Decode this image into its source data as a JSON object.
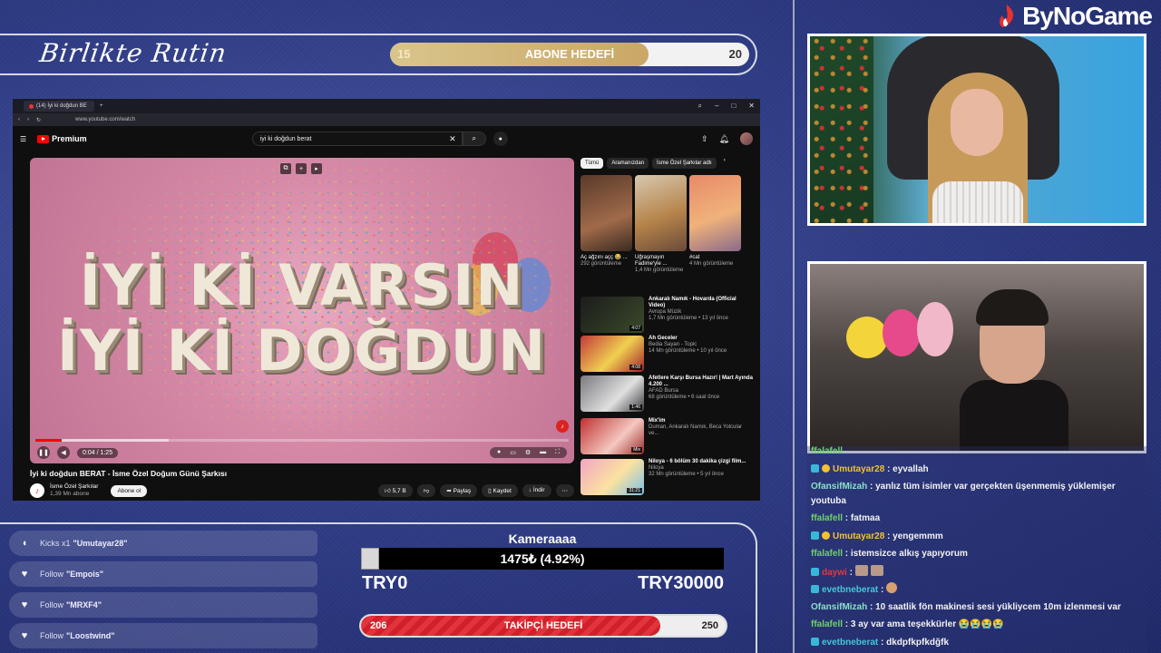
{
  "brand": {
    "name": "ByNoGame"
  },
  "banner": {
    "script_title": "Birlikte Rutin",
    "goal": {
      "label": "ABONE HEDEFİ",
      "current": "15",
      "target": "20",
      "progress": 0.72
    }
  },
  "browser": {
    "tab_title": "(14) İyi ki doğdun BE",
    "url": "www.youtube.com/watch",
    "youtube": {
      "logo": "Premium",
      "search_query": "iyi ki doğdun berat",
      "video": {
        "overlay_line1": "İYİ Kİ VARSIN",
        "overlay_line2": "İYİ Kİ DOĞDUN",
        "time": "0:04 / 1:25",
        "progress": 0.05,
        "buffered": 0.25,
        "title": "İyi ki doğdun BERAT - İsme Özel Doğum Günü Şarkısı",
        "channel": "İsme Özel Şarkılar",
        "subscribers": "1,39 Mn abone",
        "subscribe_label": "Abone ol",
        "likes": "5,7 B",
        "share_label": "Paylaş",
        "save_label": "Kaydet",
        "download_label": "İndir"
      },
      "chips": [
        "Tümü",
        "Aramanızdan",
        "İsme Özel Şarkılar adlı"
      ],
      "shorts": [
        {
          "title": "Aç ağzını açç 😂 ...",
          "views": "292 görüntüleme"
        },
        {
          "title": "Uğraşmayın Fadime'yle ...",
          "views": "1,4 Mn görüntüleme"
        },
        {
          "title": "#cat",
          "views": "4 Mn görüntüleme"
        }
      ],
      "recommendations": [
        {
          "title": "Ankaralı Namık - Hovarda (Official Video)",
          "channel": "Avrupa Müzik",
          "meta": "1,7 Mn görüntüleme • 13 yıl önce",
          "duration": "4:07"
        },
        {
          "title": "Ah Geceler",
          "channel": "Bedia Sayan - Topic",
          "meta": "14 Mn görüntüleme • 10 yıl önce",
          "duration": "4:08"
        },
        {
          "title": "Afetlere Karşı Bursa Hazır! | Mart Ayında 4.200 ...",
          "channel": "AFAD Bursa",
          "meta": "68 görüntüleme • 6 saat önce",
          "duration": "1:46"
        },
        {
          "title": "Mix'im",
          "channel": "Duman, Ankaralı Namık, Beca Yolcular ve...",
          "meta": "",
          "duration": "Mix"
        },
        {
          "title": "Niloya - 6 bölüm 30 dakika çizgi film...",
          "channel": "Niloya",
          "meta": "32 Mn görüntüleme • 5 yıl önce",
          "duration": "31:21"
        }
      ]
    }
  },
  "events": [
    {
      "type": "Kicks x1",
      "user": "\"Umutayar28\""
    },
    {
      "type": "Follow",
      "user": "\"Empois\""
    },
    {
      "type": "Follow",
      "user": "\"MRXF4\""
    },
    {
      "type": "Follow",
      "user": "\"Loostwind\""
    }
  ],
  "camera_goal": {
    "title": "Kameraaaa",
    "amount": "1475₺ (4.92%)",
    "progress": 0.0492,
    "min": "TRY0",
    "max": "TRY30000"
  },
  "follower_goal": {
    "label": "TAKİPÇİ HEDEFİ",
    "current": "206",
    "target": "250",
    "progress": 0.82
  },
  "chat": [
    {
      "user": "ffalafell",
      "text": "",
      "color": "u-green"
    },
    {
      "user": "Umutayar28",
      "text": ": eyvallah",
      "color": "u-gold"
    },
    {
      "user": "OfansifMizah",
      "text": ": yanlız tüm isimler var gerçekten üşenmemiş yüklemişer youtuba",
      "color": "u-teal"
    },
    {
      "user": "ffalafell",
      "text": ": fatmaa",
      "color": "u-green"
    },
    {
      "user": "Umutayar28",
      "text": ": yengemmm",
      "color": "u-gold"
    },
    {
      "user": "ffalafell",
      "text": ": istemsizce alkış yapıyorum",
      "color": "u-green"
    },
    {
      "user": "daywi",
      "text": ":",
      "color": "u-red"
    },
    {
      "user": "evetbneberat",
      "text": ":",
      "color": "u-cyan"
    },
    {
      "user": "OfansifMizah",
      "text": ": 10 saatlik fön makinesi sesi yükliycem 10m izlenmesi var",
      "color": "u-teal"
    },
    {
      "user": "ffalafell",
      "text": ": 3 ay var ama teşekkürler 😭😭😭😭",
      "color": "u-green"
    },
    {
      "user": "evetbneberat",
      "text": ": dkdpfkpfkdğfk",
      "color": "u-cyan"
    }
  ]
}
